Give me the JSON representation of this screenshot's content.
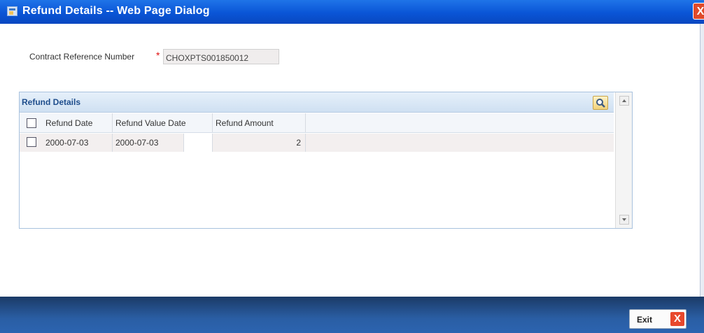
{
  "window": {
    "title": "Refund Details -- Web Page Dialog",
    "close_glyph": "X"
  },
  "form": {
    "contract_ref_label": "Contract Reference Number",
    "required_marker": "*",
    "contract_ref_value": "CHOXPTS001850012"
  },
  "grid": {
    "title": "Refund Details",
    "columns": [
      "Refund Date",
      "Refund Value Date",
      "Refund Amount"
    ],
    "rows": [
      {
        "refund_date": "2000-07-03",
        "refund_value_date": "2000-07-03",
        "refund_amount": "2"
      }
    ]
  },
  "footer": {
    "exit_label": "Exit",
    "exit_glyph": "X"
  },
  "colors": {
    "titlebar": "#0a55d6",
    "footer": "#2a5ea4",
    "accent_close": "#e8482c",
    "panel_header_text": "#1e4d8c"
  }
}
